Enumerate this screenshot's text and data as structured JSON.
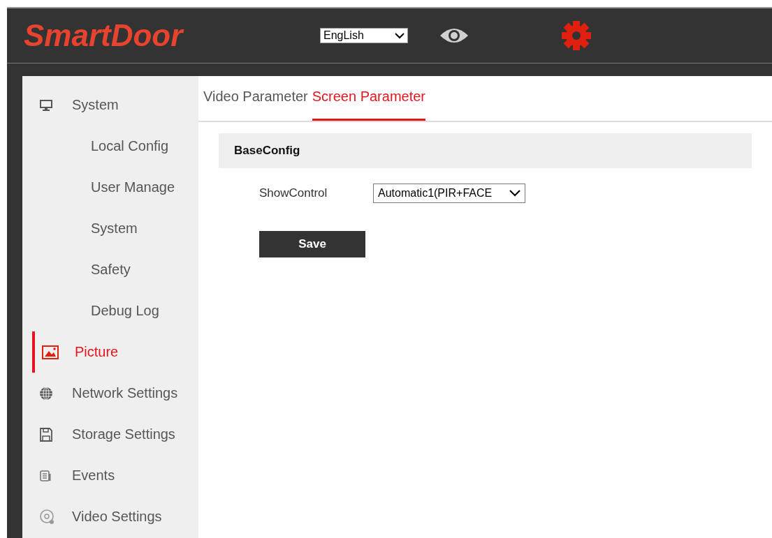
{
  "header": {
    "logo": "SmartDoor",
    "language": "EngLish"
  },
  "sidebar": {
    "items": [
      {
        "label": "System",
        "selected": false,
        "children": [
          {
            "label": "Local Config",
            "selected": false
          },
          {
            "label": "User Manage",
            "selected": false
          },
          {
            "label": "System",
            "selected": false
          },
          {
            "label": "Safety",
            "selected": false
          },
          {
            "label": "Debug Log",
            "selected": false
          }
        ]
      },
      {
        "label": "Picture",
        "selected": true
      },
      {
        "label": "Network Settings",
        "selected": false
      },
      {
        "label": "Storage Settings",
        "selected": false
      },
      {
        "label": "Events",
        "selected": false
      },
      {
        "label": "Video Settings",
        "selected": false
      }
    ]
  },
  "tabs": [
    {
      "label": "Video Parameter",
      "selected": false
    },
    {
      "label": "Screen Parameter",
      "selected": true
    }
  ],
  "section": {
    "title": "BaseConfig",
    "fields": [
      {
        "label": "ShowControl",
        "value": "Automatic1(PIR+FACE"
      }
    ],
    "save": "Save"
  }
}
